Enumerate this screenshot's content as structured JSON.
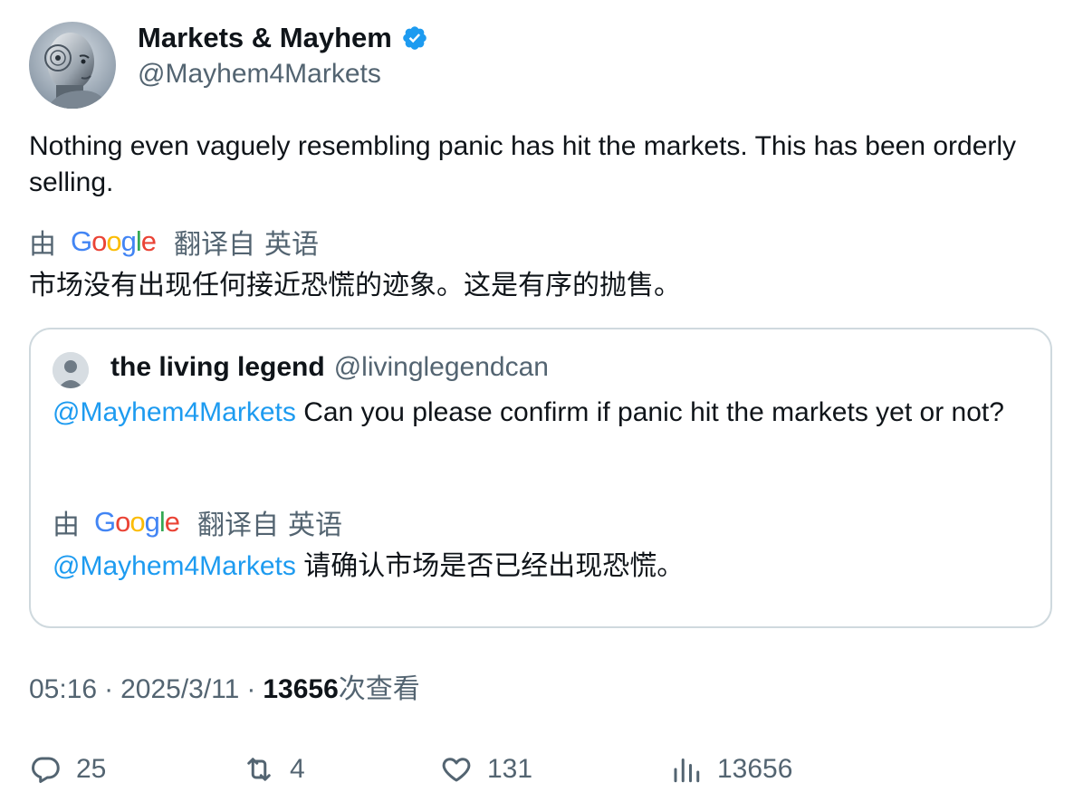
{
  "author": {
    "display_name": "Markets & Mayhem",
    "handle": "@Mayhem4Markets",
    "verified": true,
    "verified_color": "#1d9bf0"
  },
  "tweet": {
    "text": "Nothing even vaguely resembling panic has hit the markets. This has been orderly selling.",
    "translation": {
      "by": "由",
      "service": "Google",
      "translated_from": "翻译自",
      "language": "英语",
      "text": "市场没有出现任何接近恐慌的迹象。这是有序的抛售。"
    }
  },
  "quoted_tweet": {
    "display_name": "the living legend",
    "handle": "@livinglegendcan",
    "mention": "@Mayhem4Markets",
    "text": " Can you please confirm if panic hit the markets yet or not?",
    "translation": {
      "by": "由",
      "service": "Google",
      "translated_from": "翻译自",
      "language": "英语",
      "mention": "@Mayhem4Markets",
      "text": " 请确认市场是否已经出现恐慌。"
    }
  },
  "meta": {
    "time": "05:16",
    "separator": "·",
    "date": "2025/3/11",
    "views_count": "13656",
    "views_label": "次查看"
  },
  "actions": {
    "replies": "25",
    "retweets": "4",
    "likes": "131",
    "views": "13656"
  },
  "colors": {
    "link": "#1d9bf0",
    "secondary_text": "#536471",
    "primary_text": "#0f1419",
    "border": "#cfd9de"
  }
}
